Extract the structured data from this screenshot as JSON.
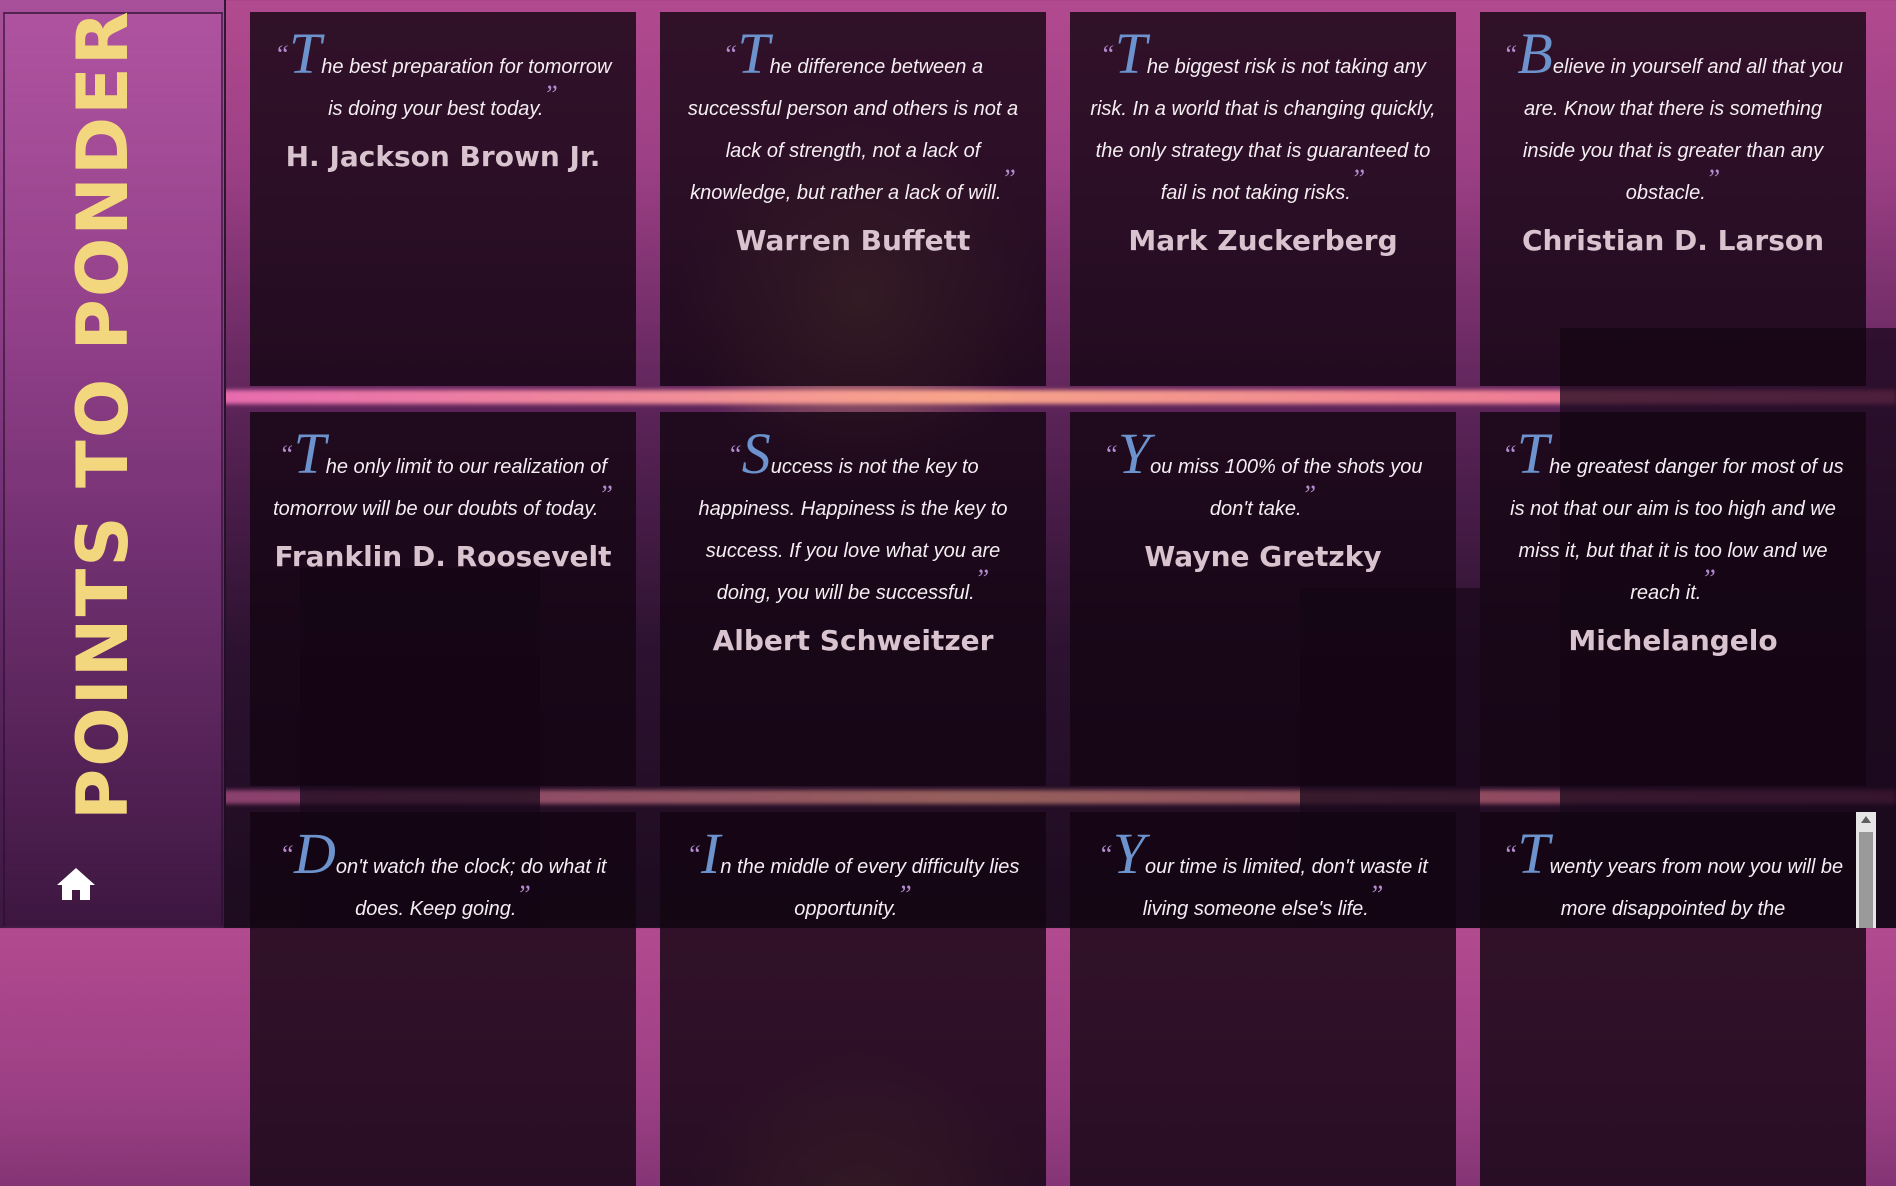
{
  "sidebar": {
    "title": "POINTS TO PONDER",
    "home_icon": "home-icon"
  },
  "colors": {
    "title": "#f3d77e",
    "dropcap": "#6c93cd",
    "quote_mark": "#b58bd0",
    "card_bg": "#140512"
  },
  "quotes": [
    {
      "first": "T",
      "rest": "he best preparation for tomorrow is doing your best today.",
      "author": "H. Jackson Brown Jr."
    },
    {
      "first": "T",
      "rest": "he difference between a successful person and others is not a lack of strength, not a lack of knowledge, but rather a lack of will.",
      "author": "Warren Buffett"
    },
    {
      "first": "T",
      "rest": "he biggest risk is not taking any risk. In a world that is changing quickly, the only strategy that is guaranteed to fail is not taking risks.",
      "author": "Mark Zuckerberg"
    },
    {
      "first": "B",
      "rest": "elieve in yourself and all that you are. Know that there is something inside you that is greater than any obstacle.",
      "author": "Christian D. Larson"
    },
    {
      "first": "T",
      "rest": "he only limit to our realization of tomorrow will be our doubts of today.",
      "author": "Franklin D. Roosevelt"
    },
    {
      "first": "S",
      "rest": "uccess is not the key to happiness. Happiness is the key to success. If you love what you are doing, you will be successful.",
      "author": "Albert Schweitzer"
    },
    {
      "first": "Y",
      "rest": "ou miss 100% of the shots you don't take.",
      "author": "Wayne Gretzky"
    },
    {
      "first": "T",
      "rest": "he greatest danger for most of us is not that our aim is too high and we miss it, but that it is too low and we reach it.",
      "author": "Michelangelo"
    },
    {
      "first": "D",
      "rest": "on't watch the clock; do what it does. Keep going.",
      "author": ""
    },
    {
      "first": "I",
      "rest": "n the middle of every difficulty lies opportunity.",
      "author": ""
    },
    {
      "first": "Y",
      "rest": "our time is limited, don't waste it living someone else's life.",
      "author": ""
    },
    {
      "first": "T",
      "rest": "wenty years from now you will be more disappointed by the",
      "author": ""
    }
  ]
}
